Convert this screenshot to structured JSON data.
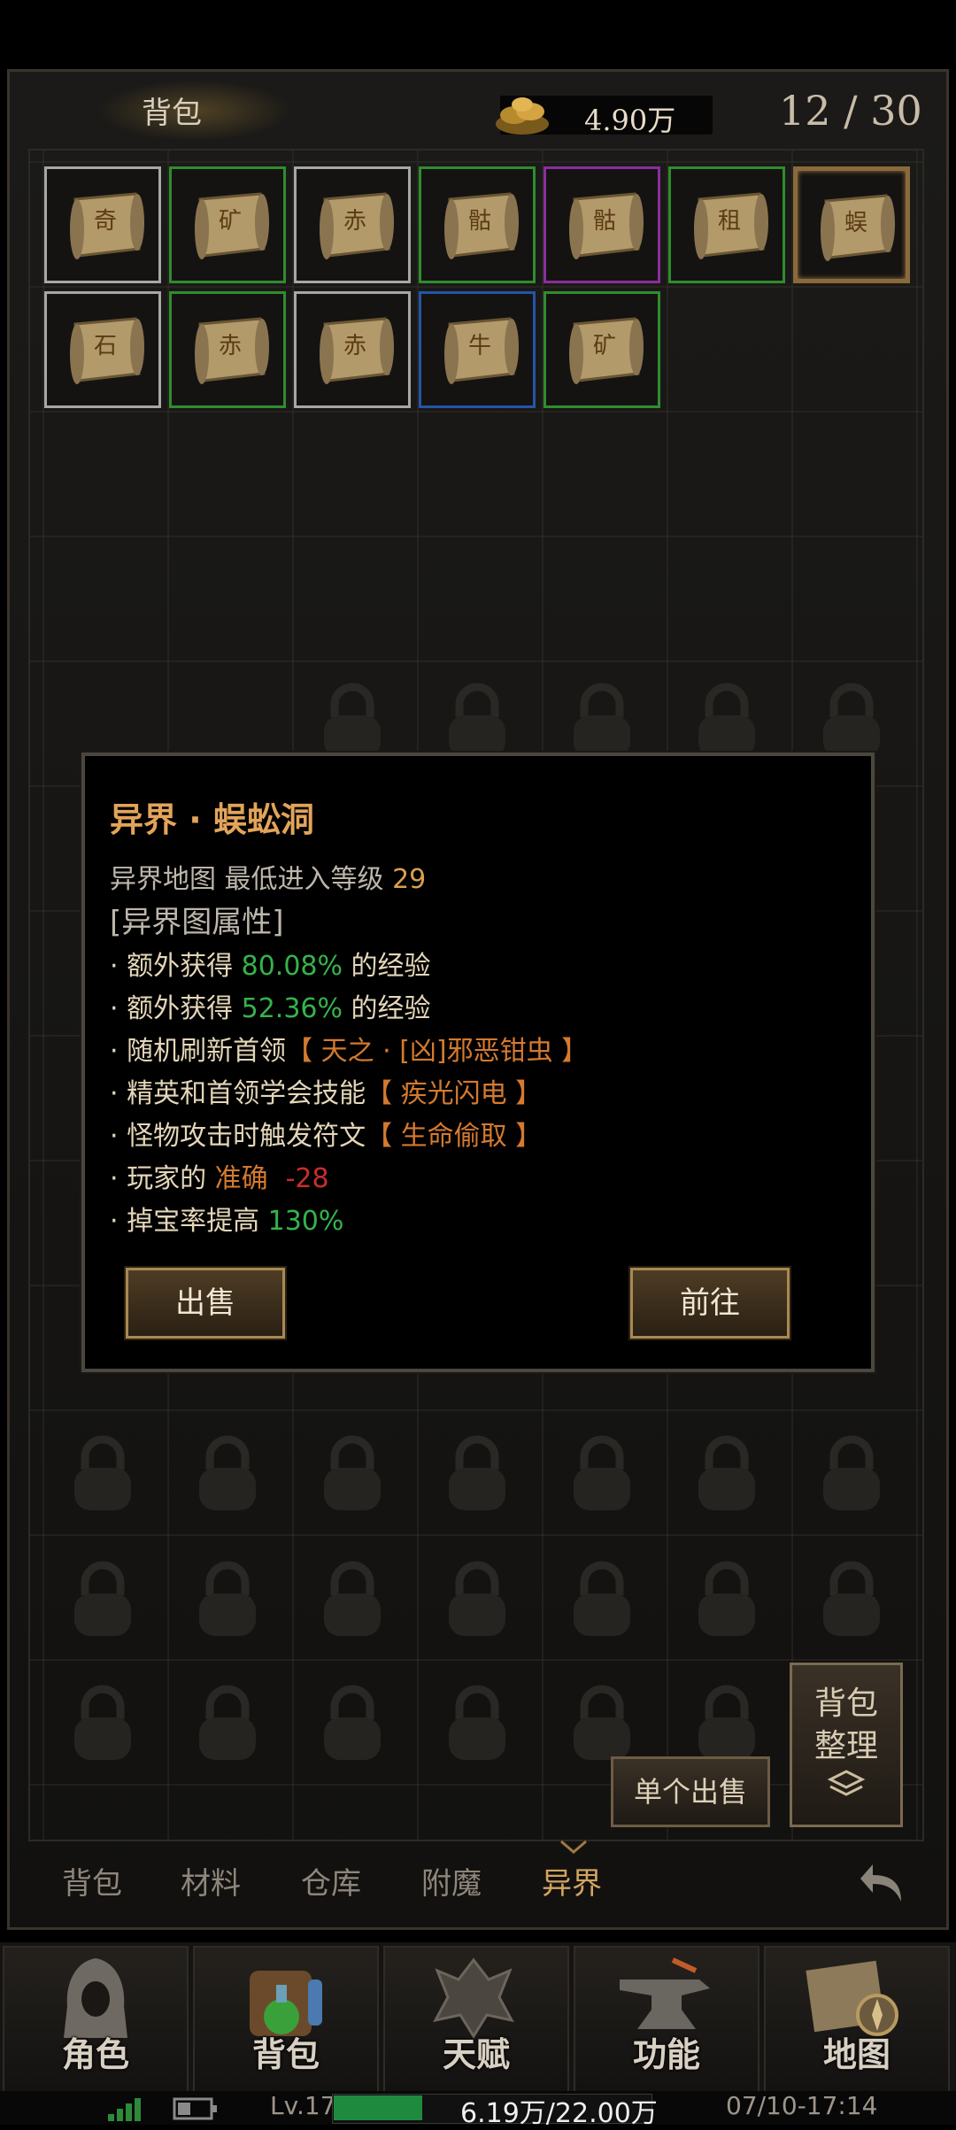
{
  "header": {
    "title": "背包",
    "gold": "4.90万",
    "capacity": "12 / 30"
  },
  "slots": [
    {
      "char": "奇",
      "rarity": "white"
    },
    {
      "char": "矿",
      "rarity": "green"
    },
    {
      "char": "赤",
      "rarity": "white"
    },
    {
      "char": "骷",
      "rarity": "green"
    },
    {
      "char": "骷",
      "rarity": "purple"
    },
    {
      "char": "租",
      "rarity": "green"
    },
    {
      "char": "蜈",
      "rarity": "selected"
    },
    {
      "char": "石",
      "rarity": "white"
    },
    {
      "char": "赤",
      "rarity": "green"
    },
    {
      "char": "赤",
      "rarity": "white"
    },
    {
      "char": "牛",
      "rarity": "blue"
    },
    {
      "char": "矿",
      "rarity": "green"
    }
  ],
  "tooltip": {
    "title": "异界 · 蜈蚣洞",
    "type_label": "异界地图",
    "min_level_label": "最低进入等级",
    "min_level": "29",
    "section": "[异界图属性]",
    "l1_pre": "· 额外获得 ",
    "l1_val": "80.08%",
    "l1_post": " 的经验",
    "l2_pre": "· 额外获得 ",
    "l2_val": "52.36%",
    "l2_post": " 的经验",
    "l3_pre": "· 随机刷新首领",
    "l3_val": "【 天之 · [凶]邪恶钳虫 】",
    "l4_pre": "· 精英和首领学会技能",
    "l4_val": "【 疾光闪电 】",
    "l5_pre": "· 怪物攻击时触发符文",
    "l5_val": "【 生命偷取 】",
    "l6_pre": "· 玩家的 ",
    "l6_mid": "准确",
    "l6_val": "-28",
    "l7_pre": "· 掉宝率提高 ",
    "l7_val": "130%",
    "sell_label": "出售",
    "go_label": "前往"
  },
  "actions": {
    "sort_l1": "背包",
    "sort_l2": "整理",
    "sell_single": "单个出售"
  },
  "tabs": [
    "背包",
    "材料",
    "仓库",
    "附魔",
    "异界"
  ],
  "active_tab": "异界",
  "nav": [
    "角色",
    "背包",
    "天赋",
    "功能",
    "地图"
  ],
  "status": {
    "level": "Lv.17",
    "xp_text": "6.19万/22.00万",
    "xp_fraction": 0.28,
    "time": "07/10-17:14"
  },
  "colors": {
    "green_border": "#2f8d2d",
    "purple_border": "#8b2e9b",
    "blue_border": "#2455a8",
    "accent": "#d2a460"
  }
}
